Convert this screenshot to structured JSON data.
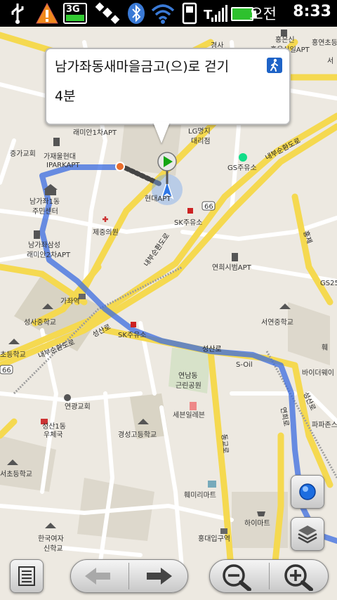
{
  "status_bar": {
    "ampm": "오전",
    "time": "8:33",
    "network": "3G",
    "icons": [
      "usb-icon",
      "warning-icon",
      "3g-icon",
      "satellite-icon",
      "bluetooth-icon",
      "wifi-icon",
      "phone-icon",
      "signal-icon",
      "battery-icon"
    ]
  },
  "callout": {
    "title": "남가좌동새마을금고(으)로 걷기",
    "duration": "4분",
    "mode_icon": "walking-icon"
  },
  "map_labels": {
    "l1": "홍은신",
    "l2": "홍연초등",
    "l3": "경사",
    "l4": "홍은신일APT",
    "l5": "래미안1차APT",
    "l6": "LG명지",
    "l7": "대리점",
    "l8": "증가교회",
    "l9": "가재울현대",
    "l10": "IPARKAPT",
    "l11": "GS주유소",
    "l12": "내부순환도로",
    "l13": "남가좌1동",
    "l14": "주민센터",
    "l15": "현대APT",
    "l16": "66",
    "l17": "SK주유소",
    "l18": "제중의원",
    "l19": "홍제",
    "l20": "남가좌삼성",
    "l21": "래미안2차APT",
    "l22": "내부순환도로",
    "l23": "연희시범APT",
    "l24": "GS25",
    "l25": "가좌역",
    "l26": "성사중학교",
    "l27": "서연중학교",
    "l28": "성산로",
    "l29": "SK주유소",
    "l30": "내부순환도로",
    "l31": "성산로",
    "l32": "S-Oil",
    "l33": "초등학교",
    "l34": "66",
    "l35": "연남동",
    "l36": "근린공원",
    "l37": "바이더웨이",
    "l38": "성산로",
    "l39": "연광교회",
    "l40": "세븐일레븐",
    "l41": "파파존스",
    "l42": "성산1동",
    "l43": "우체국",
    "l44": "경성고등학교",
    "l45": "연희로",
    "l46": "동교로",
    "l47": "서초등학교",
    "l48": "훼미리마트",
    "l49": "하이마트",
    "l50": "한국여자",
    "l51": "신학교",
    "l52": "홍대입구역",
    "l53": "서",
    "l54": "훼"
  },
  "controls": {
    "menu": "menu-icon",
    "back": "arrow-left-icon",
    "forward": "arrow-right-icon",
    "zoom_out": "zoom-out-icon",
    "zoom_in": "zoom-in-icon",
    "my_location": "my-location-icon",
    "layers": "layers-icon"
  }
}
